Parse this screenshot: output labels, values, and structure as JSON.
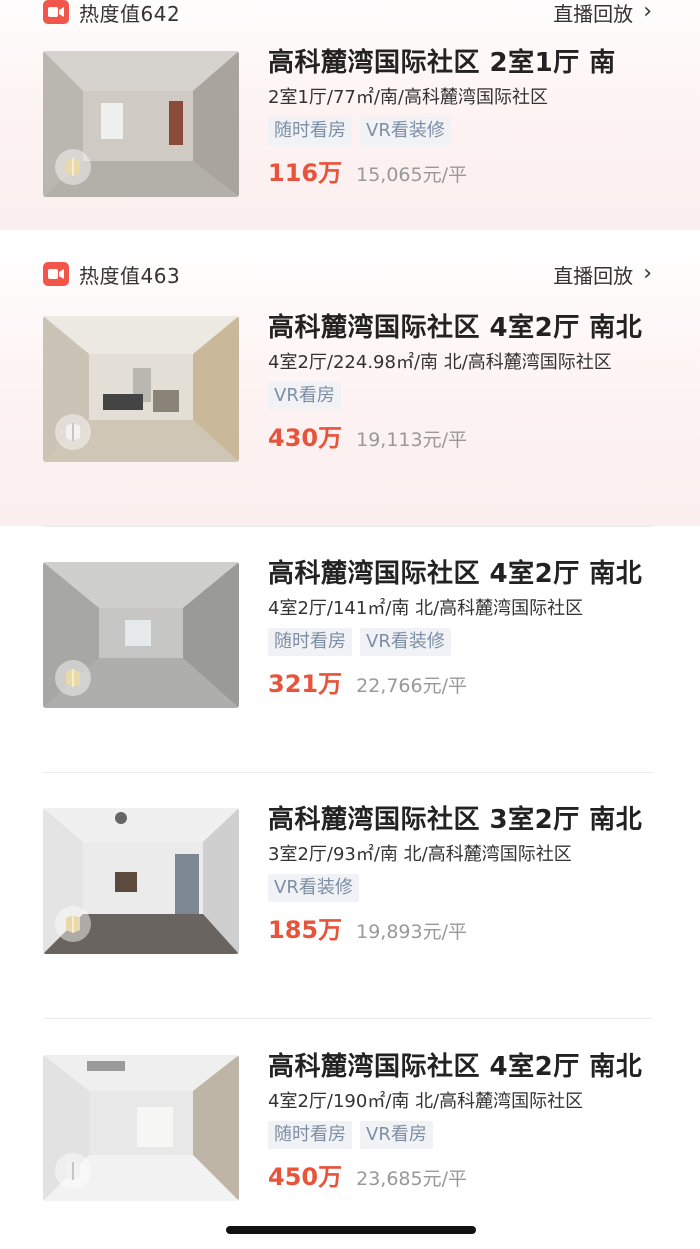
{
  "live_sections": [
    {
      "heat_label": "热度值642",
      "replay_label": "直播回放"
    },
    {
      "heat_label": "热度值463",
      "replay_label": "直播回放"
    }
  ],
  "listings": [
    {
      "title": "高科麓湾国际社区 2室1厅 南",
      "desc": "2室1厅/77㎡/南/高科麓湾国际社区",
      "tags": [
        "随时看房",
        "VR看装修"
      ],
      "price": "116万",
      "unit_price": "15,065元/平"
    },
    {
      "title": "高科麓湾国际社区 4室2厅 南北",
      "desc": "4室2厅/224.98㎡/南 北/高科麓湾国际社区",
      "tags": [
        "VR看房"
      ],
      "price": "430万",
      "unit_price": "19,113元/平"
    },
    {
      "title": "高科麓湾国际社区 4室2厅 南北",
      "desc": "4室2厅/141㎡/南 北/高科麓湾国际社区",
      "tags": [
        "随时看房",
        "VR看装修"
      ],
      "price": "321万",
      "unit_price": "22,766元/平"
    },
    {
      "title": "高科麓湾国际社区 3室2厅 南北",
      "desc": "3室2厅/93㎡/南 北/高科麓湾国际社区",
      "tags": [
        "VR看装修"
      ],
      "price": "185万",
      "unit_price": "19,893元/平"
    },
    {
      "title": "高科麓湾国际社区 4室2厅 南北",
      "desc": "4室2厅/190㎡/南 北/高科麓湾国际社区",
      "tags": [
        "随时看房",
        "VR看房"
      ],
      "price": "450万",
      "unit_price": "23,685元/平"
    }
  ],
  "icons": {
    "live": "video-camera-icon",
    "chevron": "chevron-right-icon",
    "vr": "vr-cube-icon"
  },
  "colors": {
    "price": "#e8543b",
    "live_badge": "#f2554a",
    "tag_text": "#7e8fa5",
    "tag_bg": "#f0f2f5"
  }
}
